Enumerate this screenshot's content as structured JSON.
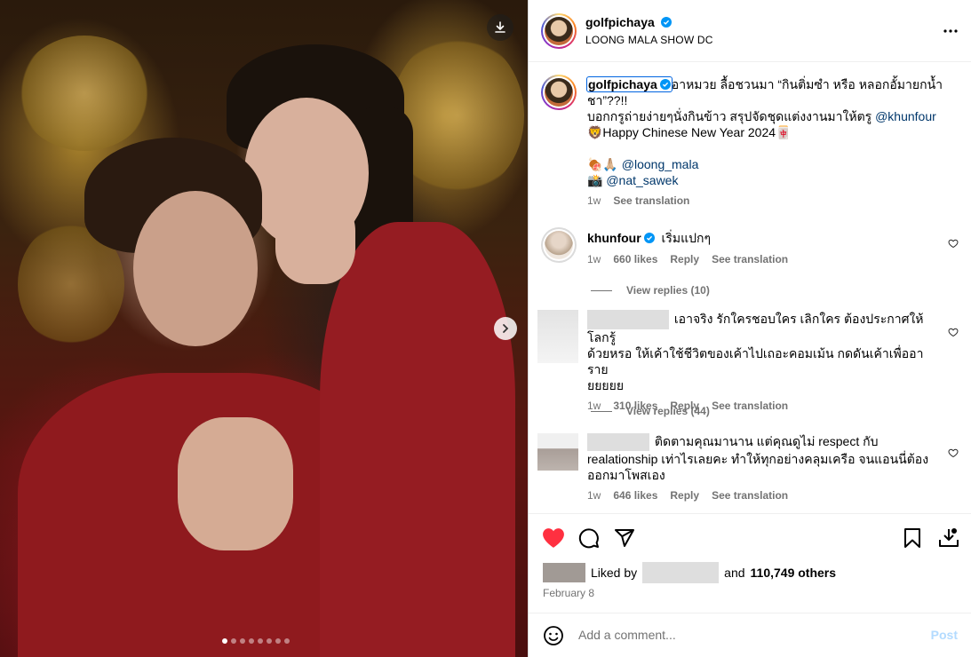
{
  "post": {
    "username": "golfpichaya",
    "location": "LOONG MALA SHOW DC",
    "more_label": "more-options"
  },
  "caption": {
    "username": "golfpichaya",
    "line1": "อาหมวย ลื้อชวนมา “กินติ่มซำ หรือ หลอกอั้มายกน้ำ",
    "line2": "ชา”??!!",
    "line3_pre": "บอกกรูถ่ายง่ายๆนั่งกินข้าว สรุปจัดชุดแต่งงานมาให้ตรู ",
    "line3_mention": "@khunfour",
    "line4": "🦁Happy Chinese New Year 2024🀄",
    "line5_emoji": "🍖🙏🏼 ",
    "line5_mention": "@loong_mala",
    "line6_emoji": "📸 ",
    "line6_mention": "@nat_sawek",
    "time": "1w",
    "see_translation": "See translation"
  },
  "comments": [
    {
      "username": "khunfour",
      "text": "เริ่มแปกๆ",
      "time": "1w",
      "likes": "660 likes",
      "reply": "Reply",
      "see_translation": "See translation",
      "view_replies": "View replies (10)"
    },
    {
      "line1": "เอาจริง รักใครชอบใคร เลิกใคร ต้องประกาศให้โลกรู้",
      "line2": "ด้วยหรอ ให้เค้าใช้ชีวิตของเค้าไปเถอะคอมเม้น กดดันเค้าเพื่ออาราย",
      "line3": "ยยยยย",
      "time": "1w",
      "likes": "310 likes",
      "reply": "Reply",
      "see_translation": "See translation",
      "view_replies": "View replies (44)"
    },
    {
      "line1": "ติดตามคุณมานาน แต่คุณดูไม่ respect กับ",
      "line2": "realationship เท่าไรเลยคะ ทำให้ทุกอย่างคลุมเครือ จนแอนนี่ต้อง",
      "line3": "ออกมาโพสเอง",
      "time": "1w",
      "likes": "646 likes",
      "reply": "Reply",
      "see_translation": "See translation"
    }
  ],
  "likes": {
    "liked_by": "Liked by",
    "and": "and",
    "others": "110,749 others"
  },
  "date": "February 8",
  "add_comment": {
    "placeholder": "Add a comment...",
    "post_label": "Post"
  },
  "carousel": {
    "total": 8,
    "active_index": 0
  },
  "colors": {
    "like_red": "#ff3040",
    "mention_blue": "#00376b",
    "post_disabled": "#b3dbff"
  }
}
